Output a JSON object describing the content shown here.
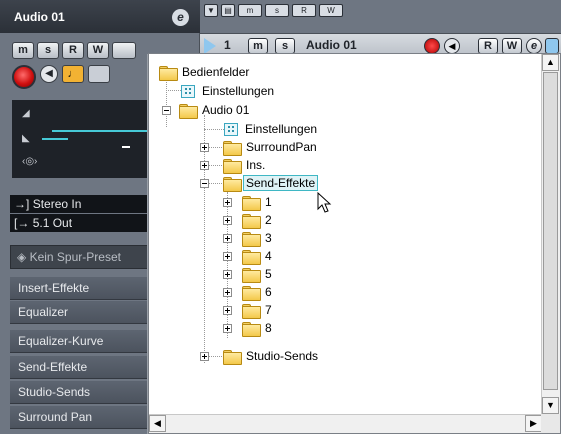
{
  "inspector": {
    "track_name": "Audio 01",
    "edit_glyph": "e",
    "buttons": [
      "m",
      "s",
      "R",
      "W"
    ],
    "io": {
      "input": "Stereo In",
      "output": "5.1 Out"
    },
    "preset": "Kein Spur-Preset",
    "sections": [
      "Insert-Effekte",
      "Equalizer",
      "Equalizer-Kurve",
      "Send-Effekte",
      "Studio-Sends",
      "Surround Pan"
    ]
  },
  "track": {
    "number": "1",
    "name": "Audio 01",
    "buttons": [
      "m",
      "s",
      "R",
      "W"
    ],
    "edit_glyph": "e"
  },
  "top_strip": [
    "m",
    "s",
    "R",
    "W"
  ],
  "tree": {
    "root": "Bedienfelder",
    "root_settings": "Einstellungen",
    "track": "Audio 01",
    "track_settings": "Einstellungen",
    "children": [
      "SurroundPan",
      "Ins.",
      "Send-Effekte"
    ],
    "sends": [
      "1",
      "2",
      "3",
      "4",
      "5",
      "6",
      "7",
      "8"
    ],
    "studio_sends": "Studio-Sends",
    "selected": "Send-Effekte"
  },
  "colors": {
    "panel": "#6e7682",
    "accent": "#46c9d6",
    "selection_border": "#3fb7c4",
    "record": "#d01010",
    "folder": "#f3c84a"
  }
}
